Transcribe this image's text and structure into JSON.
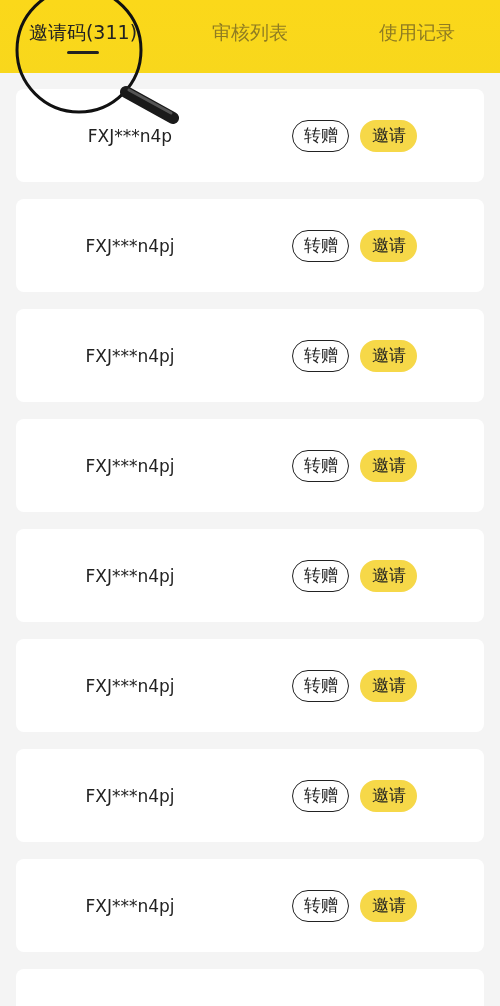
{
  "tabs": [
    {
      "label": "邀请码(311)",
      "selected": true
    },
    {
      "label": "审核列表",
      "selected": false
    },
    {
      "label": "使用记录",
      "selected": false
    }
  ],
  "codes": [
    {
      "code": "FXJ***n4p",
      "actions": [
        {
          "label": "转赠",
          "kind": "outline"
        },
        {
          "label": "邀请",
          "kind": "filled"
        }
      ]
    },
    {
      "code": "FXJ***n4pj",
      "actions": [
        {
          "label": "转赠",
          "kind": "outline"
        },
        {
          "label": "邀请",
          "kind": "filled"
        }
      ]
    },
    {
      "code": "FXJ***n4pj",
      "actions": [
        {
          "label": "转赠",
          "kind": "outline"
        },
        {
          "label": "邀请",
          "kind": "filled"
        }
      ]
    },
    {
      "code": "FXJ***n4pj",
      "actions": [
        {
          "label": "转赠",
          "kind": "outline"
        },
        {
          "label": "邀请",
          "kind": "filled"
        }
      ]
    },
    {
      "code": "FXJ***n4pj",
      "actions": [
        {
          "label": "转赠",
          "kind": "outline"
        },
        {
          "label": "邀请",
          "kind": "filled"
        }
      ]
    },
    {
      "code": "FXJ***n4pj",
      "actions": [
        {
          "label": "转赠",
          "kind": "outline"
        },
        {
          "label": "邀请",
          "kind": "filled"
        }
      ]
    },
    {
      "code": "FXJ***n4pj",
      "actions": [
        {
          "label": "转赠",
          "kind": "outline"
        },
        {
          "label": "邀请",
          "kind": "filled"
        }
      ]
    },
    {
      "code": "FXJ***n4pj",
      "actions": [
        {
          "label": "转赠",
          "kind": "outline"
        },
        {
          "label": "邀请",
          "kind": "filled"
        }
      ]
    }
  ]
}
